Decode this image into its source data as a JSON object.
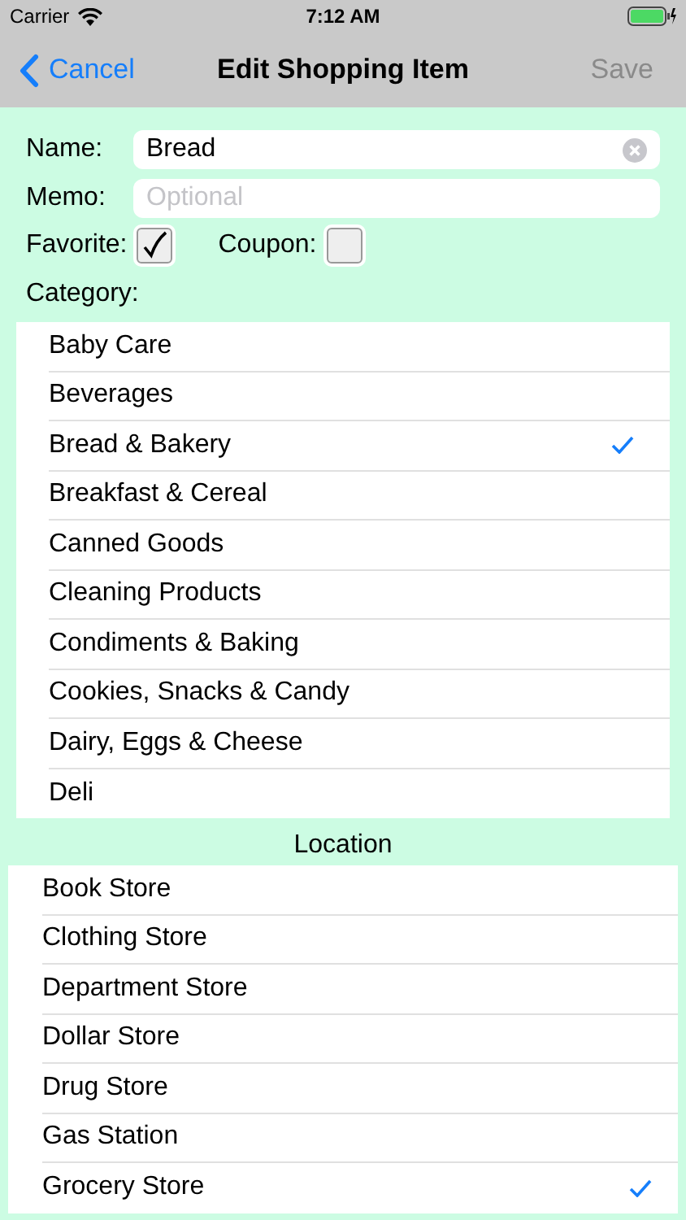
{
  "status_bar": {
    "carrier": "Carrier",
    "time": "7:12 AM"
  },
  "nav": {
    "back": "Cancel",
    "title": "Edit Shopping Item",
    "action": "Save",
    "action_disabled": true
  },
  "form": {
    "name_label": "Name:",
    "name_value": "Bread",
    "memo_label": "Memo:",
    "memo_placeholder": "Optional",
    "favorite_label": "Favorite:",
    "favorite_checked": true,
    "coupon_label": "Coupon:",
    "coupon_checked": false,
    "category_label": "Category:"
  },
  "categories": [
    {
      "label": "Baby Care",
      "selected": false
    },
    {
      "label": "Beverages",
      "selected": false
    },
    {
      "label": "Bread & Bakery",
      "selected": true
    },
    {
      "label": "Breakfast & Cereal",
      "selected": false
    },
    {
      "label": "Canned Goods",
      "selected": false
    },
    {
      "label": "Cleaning Products",
      "selected": false
    },
    {
      "label": "Condiments & Baking",
      "selected": false
    },
    {
      "label": "Cookies, Snacks & Candy",
      "selected": false
    },
    {
      "label": "Dairy, Eggs & Cheese",
      "selected": false
    },
    {
      "label": "Deli",
      "selected": false
    }
  ],
  "location_header": "Location",
  "locations": [
    {
      "label": "Book Store",
      "selected": false
    },
    {
      "label": "Clothing Store",
      "selected": false
    },
    {
      "label": "Department Store",
      "selected": false
    },
    {
      "label": "Dollar Store",
      "selected": false
    },
    {
      "label": "Drug Store",
      "selected": false
    },
    {
      "label": "Gas Station",
      "selected": false
    },
    {
      "label": "Grocery Store",
      "selected": true
    }
  ]
}
